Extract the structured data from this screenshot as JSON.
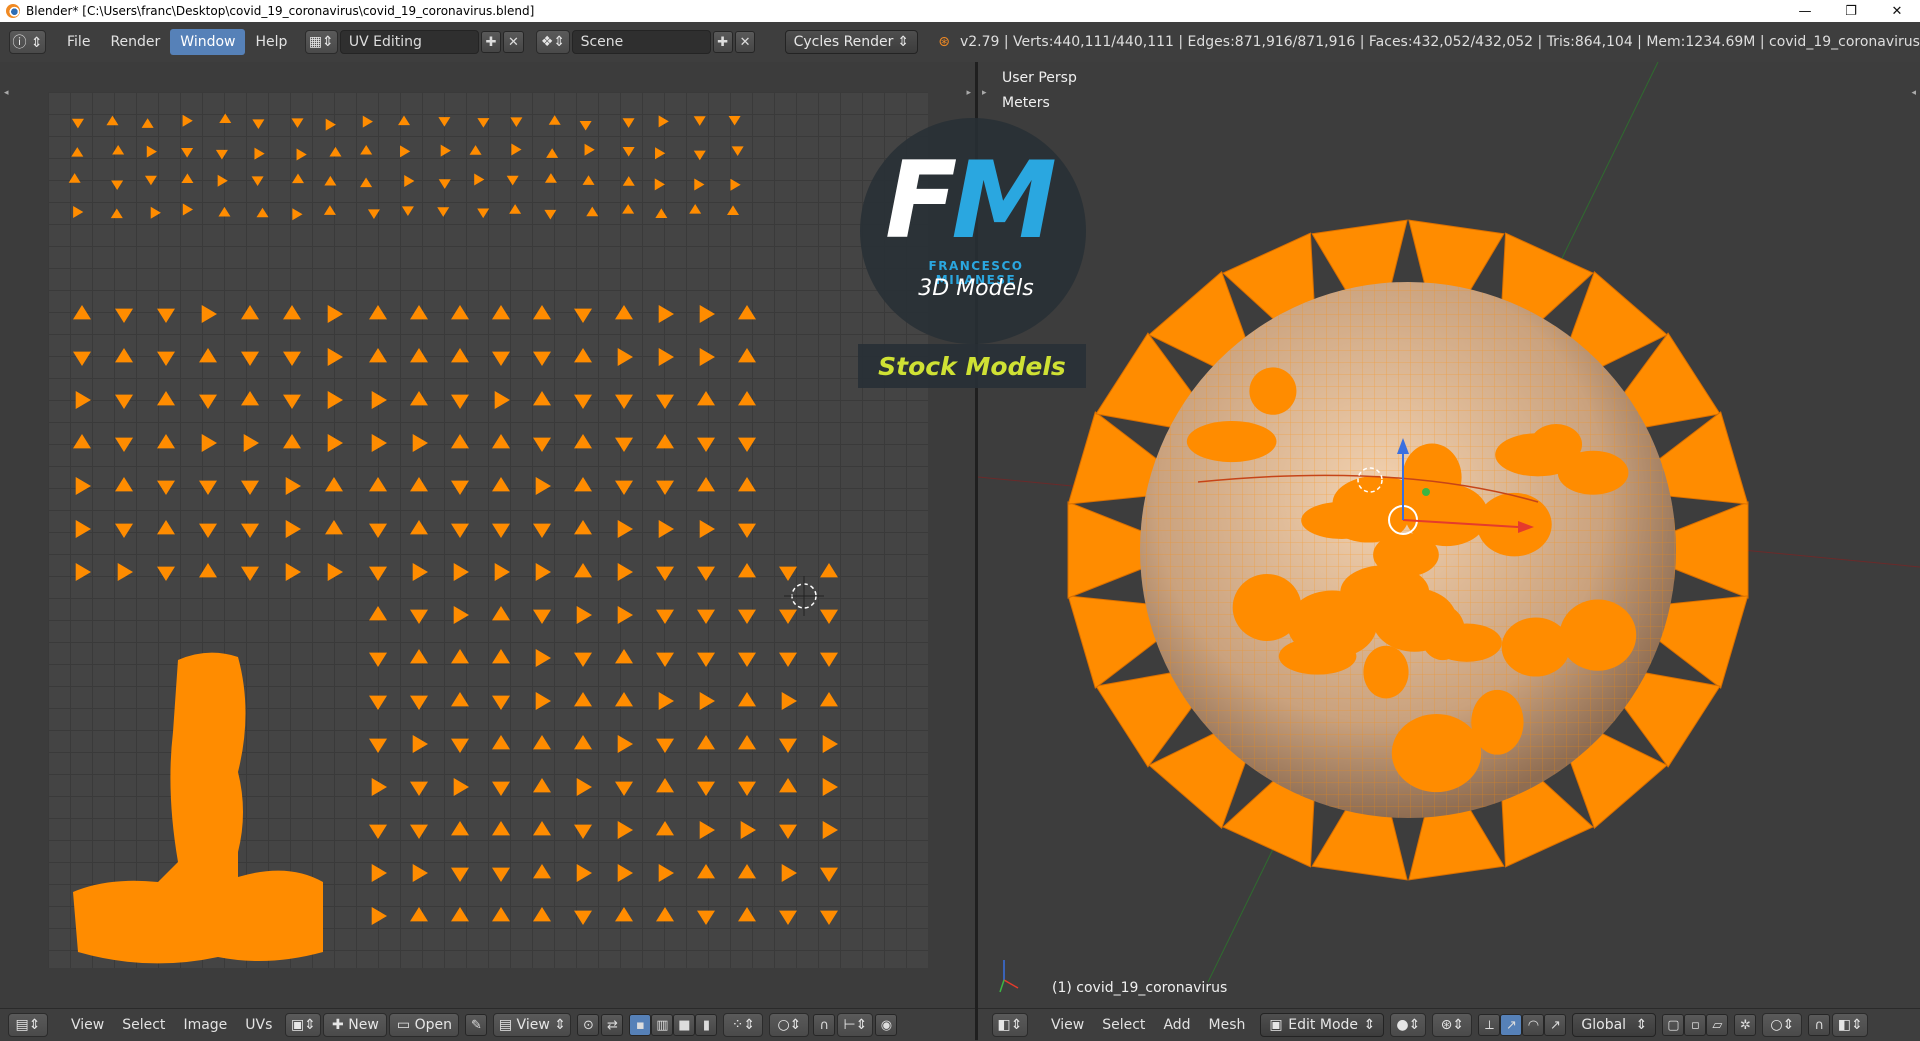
{
  "window": {
    "title": "Blender* [C:\\Users\\franc\\Desktop\\covid_19_coronavirus\\covid_19_coronavirus.blend]",
    "controls": [
      "—",
      "❐",
      "✕"
    ]
  },
  "info_header": {
    "menus": [
      "File",
      "Render",
      "Window",
      "Help"
    ],
    "active_menu": "Window",
    "screen_layout": "UV Editing",
    "scene": "Scene",
    "render_engine": "Cycles Render",
    "stats": "v2.79 | Verts:440,111/440,111 | Edges:871,916/871,916 | Faces:432,052/432,052 | Tris:864,104 | Mem:1234.69M | covid_19_coronavirus"
  },
  "viewport": {
    "view_name": "User Persp",
    "units": "Meters",
    "object_label": "(1) covid_19_coronavirus"
  },
  "uv_footer": {
    "menus": [
      "View",
      "Select",
      "Image",
      "UVs"
    ],
    "new_label": "New",
    "open_label": "Open",
    "view_label": "View"
  },
  "view3d_footer": {
    "menus": [
      "View",
      "Select",
      "Add",
      "Mesh"
    ],
    "mode": "Edit Mode",
    "orientation": "Global"
  },
  "watermark": {
    "logo_f": "F",
    "logo_m": "M",
    "name": "FRANCESCO MILANESE",
    "tagline": "3D Models",
    "stock": "Stock Models"
  },
  "colors": {
    "mesh_orange": "#ff8c00",
    "ui_dark": "#3d3d3d",
    "active_menu_blue": "#5681b8",
    "axis_red": "#e53b2c",
    "axis_green": "#3cb543",
    "axis_blue": "#3a70e0"
  },
  "icons": [
    "info-icon",
    "blender-logo-icon",
    "editor-type-icon",
    "add-icon",
    "close-icon",
    "image-icon",
    "pivot-icon",
    "sync-icon",
    "snap-icon",
    "shading-solid-icon",
    "manipulator-icon",
    "vertex-select-icon",
    "edge-select-icon",
    "face-select-icon"
  ]
}
